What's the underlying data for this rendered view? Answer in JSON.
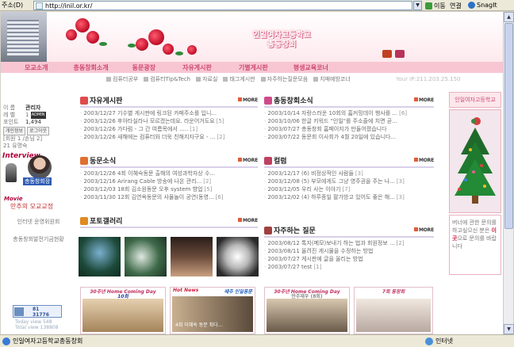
{
  "browser": {
    "address_label": "주소(D)",
    "url": "http://inil.or.kr/",
    "go_label": "이동",
    "links_label": "연결",
    "snagit_label": "SnagIt",
    "status_text": "인일여자고등학교총동창회",
    "zone_label": "인터넷"
  },
  "header": {
    "site_title_line1": "인일여자고등학교",
    "site_title_line2": "총동창회"
  },
  "nav": {
    "items": [
      "모교소개",
      "총동창회소개",
      "동문광장",
      "자유게시판",
      "기별게시판",
      "평생교육코너"
    ]
  },
  "subnav": {
    "items": [
      "컴퓨터공부",
      "컴퓨터Tip&Tech",
      "자료실",
      "태그게시판",
      "자주하는질문모음",
      "치매예방코너"
    ],
    "ip_text": "Your IP:211.203.25.150"
  },
  "login": {
    "name_label": "이 름",
    "name_value": "관리자",
    "level_label": "레 벨",
    "level_value": "1",
    "level_badge": "ADMIN",
    "point_label": "포인트",
    "point_value": "1,494",
    "btn_info": "개인정보",
    "btn_logout": "로그아웃",
    "online_line": "[회원 1 /손님 2]",
    "online_prefix": "21 유명숙"
  },
  "left": {
    "interview_label": "Interview",
    "interview_name": "총동창회장",
    "interview_sub": "회",
    "movie_label": "Movie",
    "movie_link": "만추의 모교교정",
    "menu1": "인터넷 운영위원회",
    "menu2": "총동창회발전기금현황",
    "counter_top": "81",
    "counter_bottom": "31776",
    "today_view": "Today view 548",
    "total_view": "Total view 138808"
  },
  "free_board": {
    "title": "자유게시판",
    "more": "MORE",
    "items": [
      {
        "text": "2003/12/27 기수별 게시판에 링크된 카페주소를 입니...",
        "count": ""
      },
      {
        "text": "2003/12/26 후아타실라나 모르겠는데요. 라운어거도요",
        "count": "[5]"
      },
      {
        "text": "2003/12/26 가다럼 - 그 간 여름목에서 .....",
        "count": "[1]"
      },
      {
        "text": "2003/12/26 새해에는 컴퓨터와 더욱 친해지자구요 - ...",
        "count": "[2]"
      }
    ]
  },
  "alumni_news": {
    "title": "총동창회소식",
    "more": "MORE",
    "items": [
      {
        "text": "2003/10/14 자랑스러운 10회의 홈커밍데이 행사를 ...",
        "count": "[6]"
      },
      {
        "text": "2003/10/06 한글 키워드 \"인일\"를 주소줄에 치면 곧...",
        "count": ""
      },
      {
        "text": "2003/07/27 총동창회 홈페이지가 만들어졌습니다",
        "count": ""
      },
      {
        "text": "2003/07/22 동문회 이사회가 4월 20일에 있습니다...",
        "count": ""
      }
    ]
  },
  "alumni_notice": {
    "title": "동문소식",
    "more": "MORE",
    "items": [
      {
        "text": "2003/12/26 4회 이혜숙동문 출해의 여성과학자상 수...",
        "count": ""
      },
      {
        "text": "2003/12/16 Arirang Cable 방송에 나온 관리...",
        "count": "[2]"
      },
      {
        "text": "2003/12/03 18회 김소원동문 오후 system 향업",
        "count": "[5]"
      },
      {
        "text": "2003/11/30 12회 김연옥동문의 사물놀이 공연(동영...",
        "count": "[6]"
      }
    ]
  },
  "column": {
    "title": "컬럼",
    "more": "MORE",
    "items": [
      {
        "text": "2003/12/17 (6) 비정상적인 사람들",
        "count": "[3]"
      },
      {
        "text": "2003/12/08 (5) 부모에게도 그냥 영주권을 주는 나...",
        "count": "[3]"
      },
      {
        "text": "2003/12/05 우리 사는 이야기",
        "count": "[7]"
      },
      {
        "text": "2003/12/02 (4) 하루종일 팔가방고 있어도 좋은 해...",
        "count": "[3]"
      }
    ]
  },
  "photo_gallery": {
    "title": "포토갤러리",
    "more": "MORE"
  },
  "faq": {
    "title": "자주하는 질문",
    "more": "MORE",
    "items": [
      {
        "text": "2003/08/12 톡지(메모)보내기 하는 법과 회원정보 ...",
        "count": "[2]"
      },
      {
        "text": "2003/08/11 올려진 게시물을 수정하는 방법",
        "count": ""
      },
      {
        "text": "2003/07/27 게시판에 글을 올리는 방법",
        "count": ""
      },
      {
        "text": "2003/07/27 test",
        "count": "[1]"
      }
    ]
  },
  "banners": [
    {
      "title": "30주년 Home Coming Day",
      "sub": "10회"
    },
    {
      "title": "Hot News",
      "sub": "때주 인일동문",
      "caption": "4회 이혜숙 동문 최다…"
    },
    {
      "title": "30주년 Home Coming Day",
      "sub": "만주재우 (8회)"
    },
    {
      "title": "7회 동창회",
      "sub": ""
    }
  ],
  "right": {
    "box1_title": "인일여자고등학교",
    "contact_text": "버너에 관한 문의를 하고싶으신 분은",
    "contact_bold": "이곳",
    "contact_tail": "으로 문의를 바랍니다"
  }
}
